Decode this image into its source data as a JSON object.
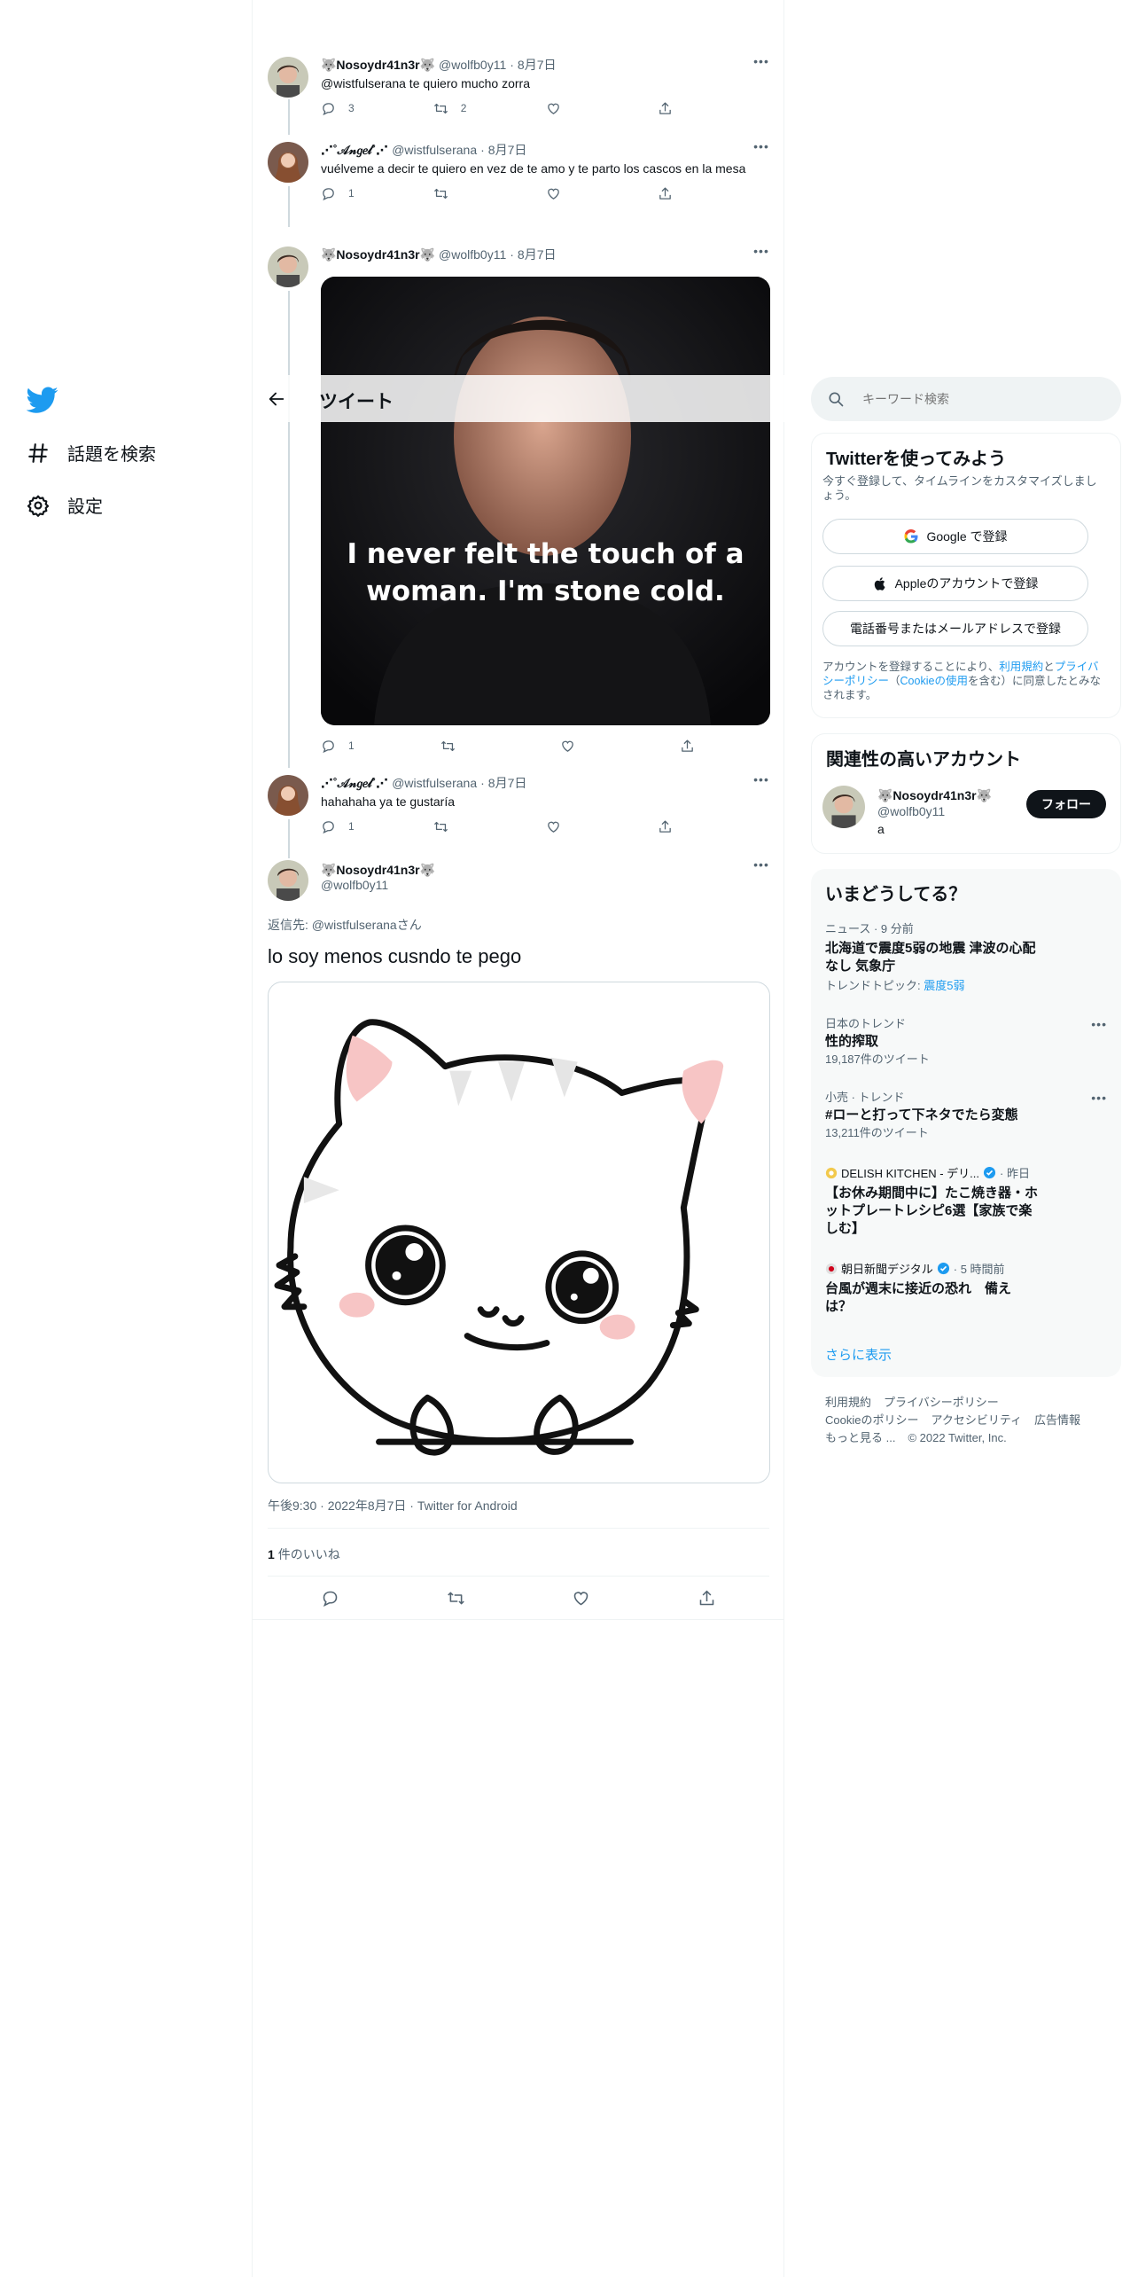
{
  "nav": {
    "explore_label": "話題を検索",
    "settings_label": "設定"
  },
  "header": {
    "title": "ツイート"
  },
  "thread": [
    {
      "name": "🐺Nosoydr41n3r🐺",
      "handle": "@wolfb0y11",
      "time": "8月7日",
      "text": "@wistfulserana te quiero mucho zorra",
      "replies": "3",
      "retweets": "2",
      "likes": ""
    },
    {
      "name": "⋰˚𝒜𝓃𝑔𝑒𝓁˚⋰",
      "handle": "@wistfulserana",
      "time": "8月7日",
      "text": "vuélveme a decir te quiero en vez de te amo y te parto los cascos en la mesa",
      "replies": "1",
      "retweets": "",
      "likes": ""
    },
    {
      "name": "🐺Nosoydr41n3r🐺",
      "handle": "@wolfb0y11",
      "time": "8月7日",
      "text": "",
      "media_caption": "I never felt the touch of a woman. I'm stone cold.",
      "replies": "1",
      "retweets": "",
      "likes": ""
    },
    {
      "name": "⋰˚𝒜𝓃𝑔𝑒𝓁˚⋰",
      "handle": "@wistfulserana",
      "time": "8月7日",
      "text": "hahahaha ya te gustaría",
      "replies": "1",
      "retweets": "",
      "likes": ""
    }
  ],
  "focused": {
    "name": "🐺Nosoydr41n3r🐺",
    "handle": "@wolfb0y11",
    "reply_to_prefix": "返信先: ",
    "reply_to_handle": "@wistfulserana",
    "reply_to_suffix": "さん",
    "text": "lo soy menos cusndo te pego",
    "timestamp": "午後9:30 · 2022年8月7日 · Twitter for Android",
    "like_count": "1",
    "like_label": "件のいいね"
  },
  "right": {
    "search_placeholder": "キーワード検索",
    "signup": {
      "title": "Twitterを使ってみよう",
      "subtitle": "今すぐ登録して、タイムラインをカスタマイズしましょう。",
      "google_label": "Google で登録",
      "apple_label": "Appleのアカウントで登録",
      "phone_label": "電話番号またはメールアドレスで登録",
      "terms_pre": "アカウントを登録することにより、",
      "terms_link1": "利用規約",
      "terms_mid": "と",
      "terms_link2": "プライバシーポリシー",
      "terms_paren_open": "（",
      "terms_link3": "Cookieの使用",
      "terms_post": "を含む）に同意したとみなされます。"
    },
    "relevant": {
      "title": "関連性の高いアカウント",
      "name": "🐺Nosoydr41n3r🐺",
      "handle": "@wolfb0y11",
      "bio": "a",
      "follow_label": "フォロー"
    },
    "trends": {
      "title": "いまどうしてる？",
      "items": [
        {
          "meta": "ニュース · 9 分前",
          "title": "北海道で震度5弱の地震 津波の心配なし 気象庁",
          "sub_prefix": "トレンドトピック: ",
          "sub_link": "震度5弱"
        },
        {
          "meta": "日本のトレンド",
          "title": "性的搾取",
          "sub": "19,187件のツイート"
        },
        {
          "meta": "小売 · トレンド",
          "title": "#ローと打って下ネタでたら変態",
          "sub": "13,211件のツイート"
        },
        {
          "source": "DELISH KITCHEN - デリ...",
          "time": "· 昨日",
          "title": "【お休み期間中に】たこ焼き器・ホットプレートレシピ6選【家族で楽しむ】"
        },
        {
          "source": "朝日新聞デジタル",
          "time": "· 5 時間前",
          "title": "台風が週末に接近の恐れ　備えは？"
        }
      ],
      "show_more": "さらに表示"
    },
    "footer": {
      "terms": "利用規約",
      "privacy": "プライバシーポリシー",
      "cookies": "Cookieのポリシー",
      "accessibility": "アクセシビリティ",
      "ads": "広告情報",
      "more": "もっと見る ...",
      "copyright": "© 2022 Twitter, Inc."
    }
  },
  "colors": {
    "accent": "#1d9bf0",
    "text": "#0f1419",
    "muted": "#536471",
    "border": "#eff3f4"
  }
}
